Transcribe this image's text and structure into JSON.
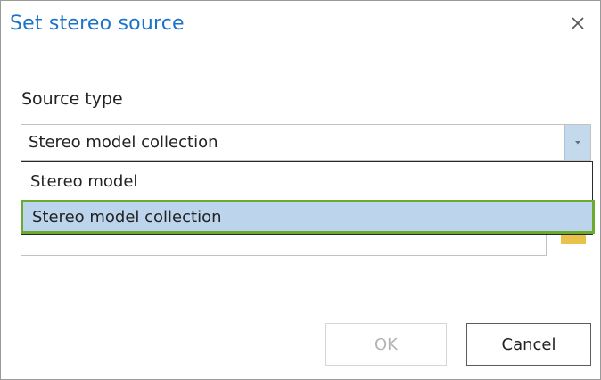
{
  "dialog": {
    "title": "Set stereo source",
    "close_icon": "close-icon"
  },
  "source_type": {
    "label": "Source type",
    "selected_value": "Stereo model collection",
    "dropdown_icon": "chevron-down-icon",
    "options": [
      {
        "label": "Stereo model",
        "highlighted": false
      },
      {
        "label": "Stereo model collection",
        "highlighted": true
      }
    ]
  },
  "path_field": {
    "value": "",
    "browse_icon": "folder-icon"
  },
  "buttons": {
    "ok_label": "OK",
    "ok_enabled": false,
    "cancel_label": "Cancel"
  },
  "colors": {
    "title": "#1a73c8",
    "highlight": "#bcd4ec",
    "highlight_border": "#6aaa2e"
  }
}
